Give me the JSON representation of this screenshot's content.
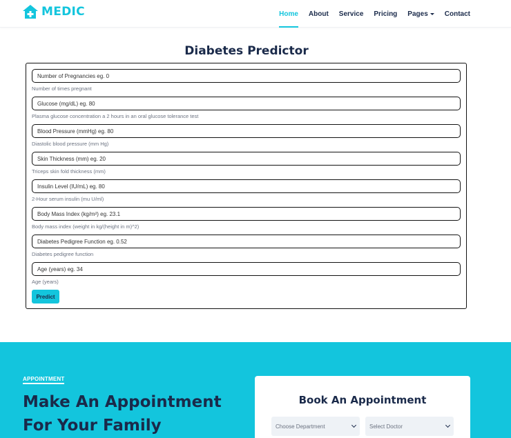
{
  "brand": {
    "name": "MEDIC",
    "icon": "hospital-cross-icon",
    "color": "#13c5dd"
  },
  "nav": {
    "items": [
      {
        "label": "Home",
        "active": true
      },
      {
        "label": "About",
        "active": false
      },
      {
        "label": "Service",
        "active": false
      },
      {
        "label": "Pricing",
        "active": false
      },
      {
        "label": "Pages",
        "active": false,
        "dropdown": true
      },
      {
        "label": "Contact",
        "active": false
      }
    ]
  },
  "predictor": {
    "title": "Diabetes Predictor",
    "fields": [
      {
        "placeholder": "Number of Pregnancies eg. 0",
        "help": "Number of times pregnant"
      },
      {
        "placeholder": "Glucose (mg/dL) eg. 80",
        "help": "Plasma glucose concentration a 2 hours in an oral glucose tolerance test"
      },
      {
        "placeholder": "Blood Pressure (mmHg) eg. 80",
        "help": "Diastolic blood pressure (mm Hg)"
      },
      {
        "placeholder": "Skin Thickness (mm) eg. 20",
        "help": "Triceps skin fold thickness (mm)"
      },
      {
        "placeholder": "Insulin Level (IU/mL) eg. 80",
        "help": "2-Hour serum insulin (mu U/ml)"
      },
      {
        "placeholder": "Body Mass Index (kg/m²) eg. 23.1",
        "help": "Body mass index (weight in kg/(height in m)^2)"
      },
      {
        "placeholder": "Diabetes Pedigree Function eg. 0.52",
        "help": "Diabetes pedigree function"
      },
      {
        "placeholder": "Age (years) eg. 34",
        "help": "Age (years)"
      }
    ],
    "button_label": "Predict"
  },
  "appointment": {
    "kicker": "APPOINTMENT",
    "heading": "Make An Appointment For Your Family",
    "card_title": "Book An Appointment",
    "department_select": "Choose Department",
    "doctor_select": "Select Doctor"
  },
  "colors": {
    "accent": "#13c5dd",
    "dark": "#1a2a4a"
  }
}
